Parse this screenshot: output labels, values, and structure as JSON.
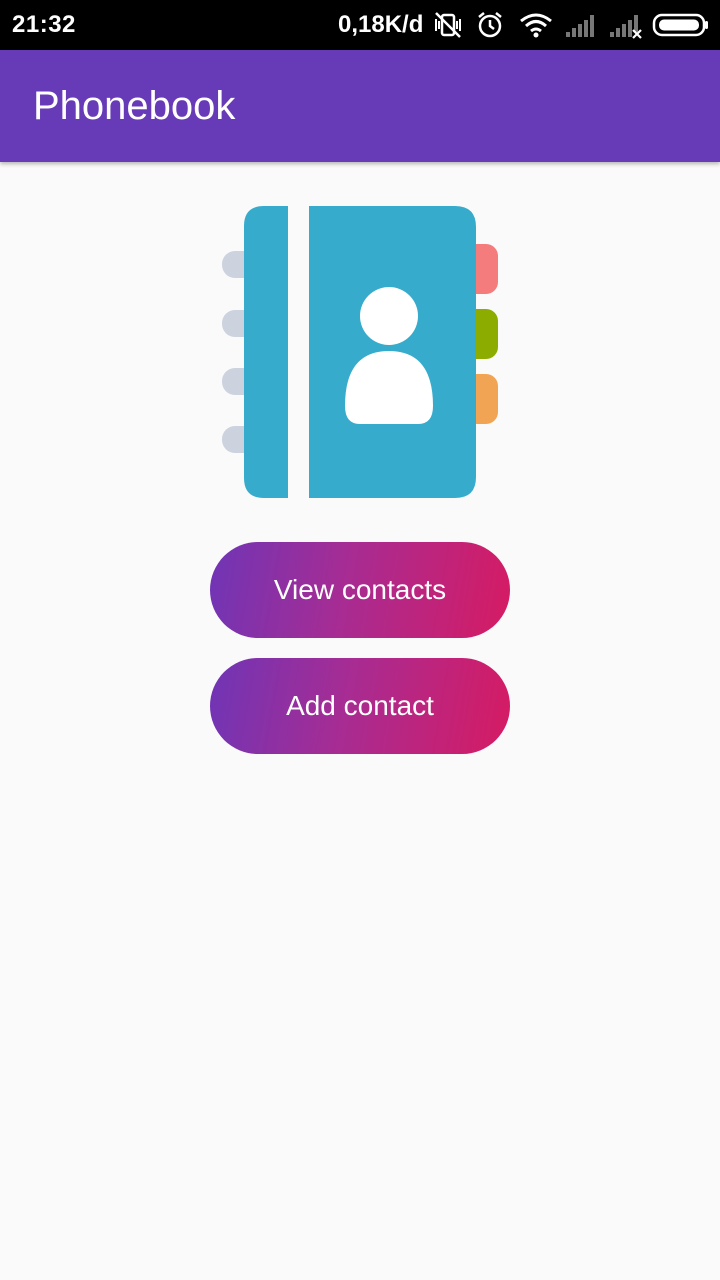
{
  "status_bar": {
    "time": "21:32",
    "network_speed": "0,18K/d",
    "icons": [
      "vibrate-off-icon",
      "alarm-icon",
      "wifi-icon",
      "signal-icon",
      "signal-no-service-icon",
      "battery-icon"
    ]
  },
  "app_bar": {
    "title": "Phonebook",
    "color": "#673ab7"
  },
  "illustration": {
    "icon": "address-book-icon",
    "colors": {
      "cover": "#36abcc",
      "rings": "#ccd3df",
      "tab_1": "#f47c7c",
      "tab_2": "#8cad00",
      "tab_3": "#f2a455"
    }
  },
  "actions": {
    "view_contacts_label": "View contacts",
    "add_contact_label": "Add contact",
    "gradient_start": "#6f35b6",
    "gradient_end": "#d61b63"
  }
}
